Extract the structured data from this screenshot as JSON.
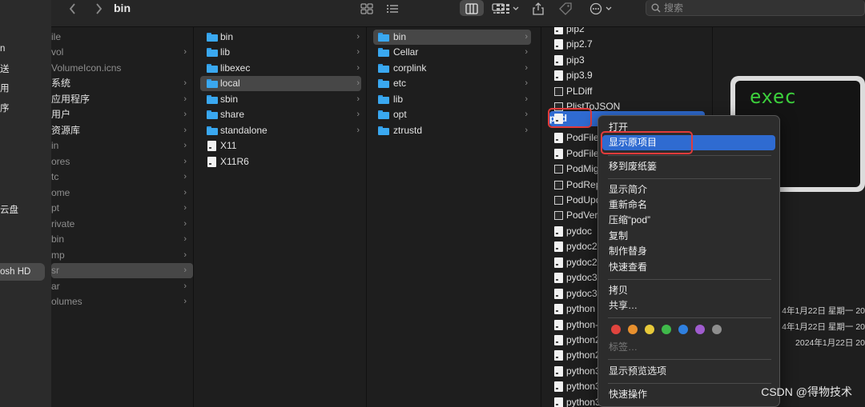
{
  "window": {
    "title": "bin"
  },
  "search": {
    "placeholder": "搜索"
  },
  "sidebar": {
    "items": [
      "n",
      "送",
      "用",
      "序",
      "云盘",
      "osh HD"
    ]
  },
  "col1": {
    "items": [
      "ile",
      "vol",
      "VolumeIcon.icns",
      "系统",
      "应用程序",
      "用户",
      "资源库",
      "in",
      "ores",
      "tc",
      "ome",
      "pt",
      "rivate",
      "bin",
      "mp",
      "sr",
      "ar",
      "olumes"
    ]
  },
  "col2": {
    "items": [
      "bin",
      "lib",
      "libexec",
      "local",
      "sbin",
      "share",
      "standalone",
      "X11",
      "X11R6"
    ]
  },
  "col3": {
    "items": [
      "bin",
      "Cellar",
      "corplink",
      "etc",
      "lib",
      "opt",
      "ztrustd"
    ]
  },
  "col4": {
    "items": [
      "pip2",
      "pip2.7",
      "pip3",
      "pip3.9",
      "PLDiff",
      "PlistToJSON",
      "pod",
      "PodFile",
      "PodFile",
      "PodMig",
      "PodRep",
      "PodUpd",
      "PodVer",
      "pydoc",
      "pydoc2",
      "pydoc2",
      "pydoc3",
      "pydoc3",
      "python",
      "python-",
      "python2",
      "python2",
      "python3",
      "python3",
      "python3"
    ]
  },
  "menu": {
    "open": "打开",
    "show_original": "显示原项目",
    "move_to_trash": "移到废纸篓",
    "get_info": "显示简介",
    "rename": "重新命名",
    "compress": "压缩“pod”",
    "duplicate": "复制",
    "make_alias": "制作替身",
    "quick_look": "快速查看",
    "copy": "拷贝",
    "share": "共享…",
    "tags": "标签…",
    "show_view_options": "显示预览选项",
    "quick_actions": "快速操作",
    "tag_colors": [
      "#e0443e",
      "#e8902e",
      "#e7c93a",
      "#3fb94a",
      "#2f80e0",
      "#a05ccf",
      "#8e8e8e"
    ]
  },
  "preview": {
    "icon_text": "exec",
    "dates": [
      "4年1月22日 星期一 20",
      "4年1月22日 星期一 20",
      "2024年1月22日 20"
    ]
  },
  "watermark": "CSDN @得物技术"
}
